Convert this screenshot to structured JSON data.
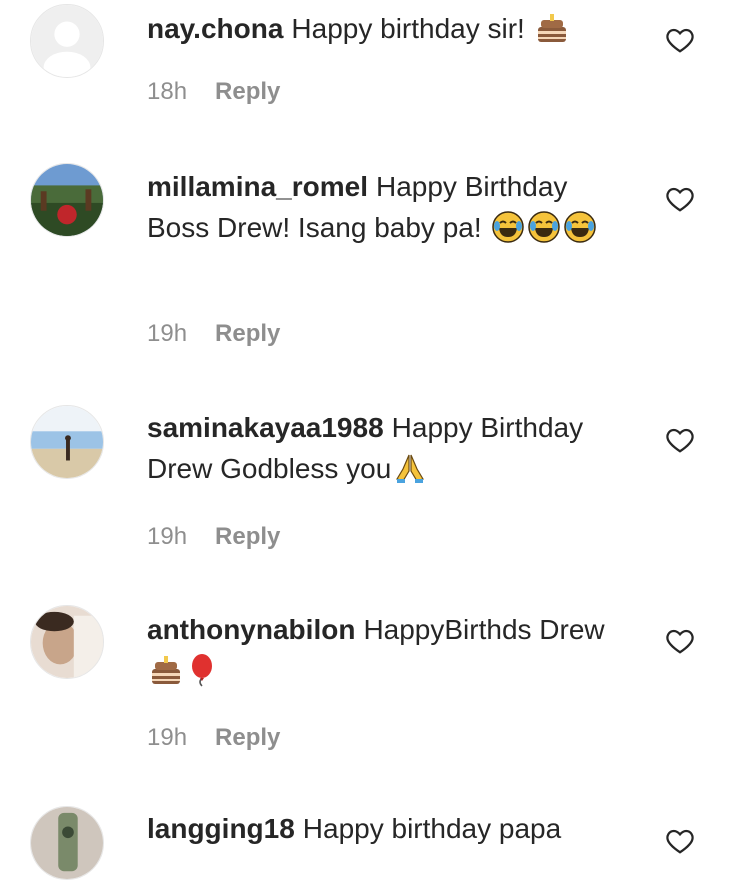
{
  "comments": [
    {
      "username": "nay.chona",
      "text": "Happy birthday sir! ",
      "emojis": [
        "cake"
      ],
      "time": "18h",
      "reply_label": "Reply"
    },
    {
      "username": "millamina_romel",
      "text": "Happy Birthday Boss Drew! Isang baby pa! ",
      "emojis": [
        "joy",
        "joy",
        "joy"
      ],
      "time": "19h",
      "reply_label": "Reply"
    },
    {
      "username": "saminakayaa1988",
      "text": "Happy Birthday Drew Godbless you",
      "emojis": [
        "pray"
      ],
      "time": "19h",
      "reply_label": "Reply"
    },
    {
      "username": "anthonynabilon",
      "text": "HappyBirthds Drew",
      "emojis": [
        "cake",
        "balloon"
      ],
      "time": "19h",
      "reply_label": "Reply"
    },
    {
      "username": "langging18",
      "text": "Happy birthday papa",
      "emojis": [],
      "time": "",
      "reply_label": ""
    }
  ],
  "colors": {
    "text": "#262626",
    "meta": "#8e8e8e"
  },
  "icons": {
    "like": "heart-outline-icon"
  }
}
